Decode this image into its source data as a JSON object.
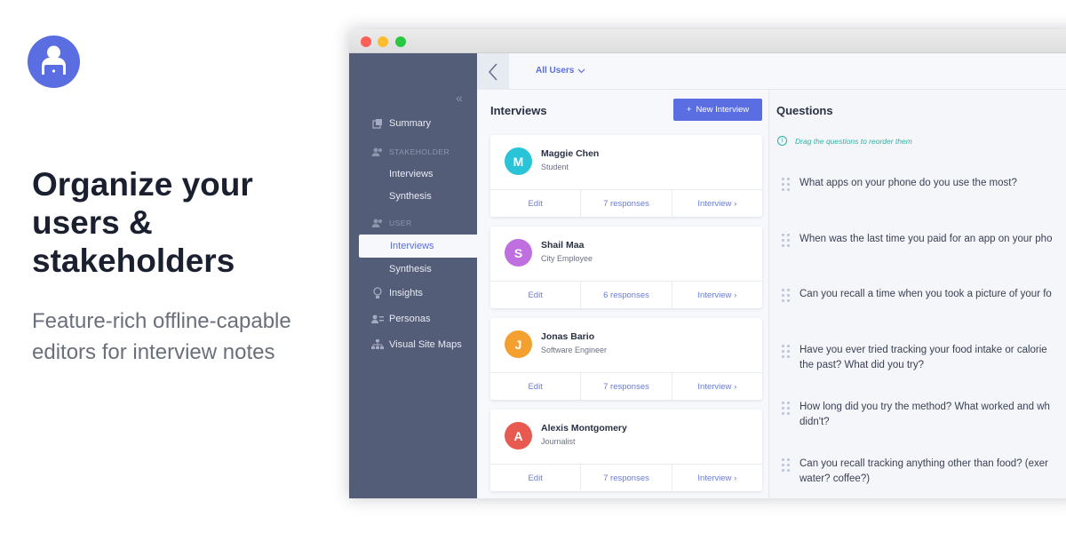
{
  "promo": {
    "headline": "Organize your users & stakeholders",
    "subline": "Feature-rich offline-capable editors for interview notes"
  },
  "topbar": {
    "filter": "All Users"
  },
  "sidebar": {
    "items": [
      {
        "label": "Summary",
        "icon": "summary-icon"
      },
      {
        "label": "STAKEHOLDER",
        "icon": "users-icon"
      },
      {
        "label": "Interviews"
      },
      {
        "label": "Synthesis"
      },
      {
        "label": "USER",
        "icon": "users-icon"
      },
      {
        "label": "Interviews",
        "active": true
      },
      {
        "label": "Synthesis"
      },
      {
        "label": "Insights",
        "icon": "lightbulb-icon"
      },
      {
        "label": "Personas",
        "icon": "personas-icon"
      },
      {
        "label": "Visual Site Maps",
        "icon": "sitemap-icon"
      }
    ]
  },
  "interviews": {
    "title": "Interviews",
    "new_button": "New Interview",
    "cards": [
      {
        "initial": "M",
        "name": "Maggie Chen",
        "role": "Student",
        "color": "#2ac4d9",
        "edit": "Edit",
        "responses": "7 responses",
        "interview": "Interview"
      },
      {
        "initial": "S",
        "name": "Shail Maa",
        "role": "City Employee",
        "color": "#c06fe0",
        "edit": "Edit",
        "responses": "6 responses",
        "interview": "Interview"
      },
      {
        "initial": "J",
        "name": "Jonas Bario",
        "role": "Software Engineer",
        "color": "#f4a031",
        "edit": "Edit",
        "responses": "7 responses",
        "interview": "Interview"
      },
      {
        "initial": "A",
        "name": "Alexis Montgomery",
        "role": "Journalist",
        "color": "#e85a4f",
        "edit": "Edit",
        "responses": "7 responses",
        "interview": "Interview"
      }
    ]
  },
  "questions": {
    "title": "Questions",
    "hint": "Drag the questions to reorder them",
    "items": [
      {
        "line1": "What apps on your phone do you use the most?",
        "line2": ""
      },
      {
        "line1": "When was the last time you paid for an app on your pho",
        "line2": ""
      },
      {
        "line1": "Can you recall a time when you took a picture of your fo",
        "line2": ""
      },
      {
        "line1": "Have you ever tried tracking your food intake or calorie",
        "line2": "the past? What did you try?"
      },
      {
        "line1": "How long did you try the method? What worked and wh",
        "line2": "didn't?"
      },
      {
        "line1": "Can you recall tracking anything other than food? (exer",
        "line2": "water? coffee?)"
      }
    ]
  }
}
